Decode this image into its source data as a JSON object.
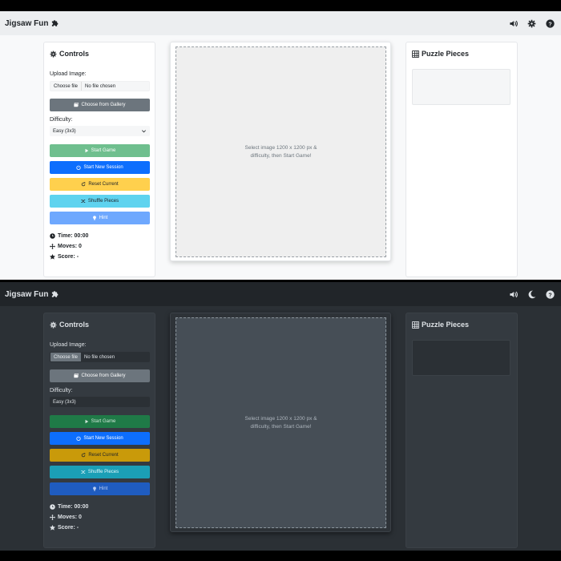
{
  "app": {
    "title": "Jigsaw Fun",
    "brand_icon": "puzzle-icon"
  },
  "controls": {
    "title": "Controls",
    "upload_label": "Upload Image:",
    "file_button": "Choose file",
    "file_status": "No file chosen",
    "gallery_button": "Choose from Gallery",
    "difficulty_label": "Difficulty:",
    "difficulty_value": "Easy (3x3)",
    "start_button": "Start Game",
    "new_session_button": "Start New Session",
    "reset_button": "Reset Current",
    "shuffle_button": "Shuffle Pieces",
    "hint_button": "Hint"
  },
  "stats": {
    "time": "Time: 00:00",
    "moves": "Moves: 0",
    "score": "Score: -"
  },
  "board": {
    "placeholder": "Select image 1200 x 1200 px & difficulty, then Start Game!"
  },
  "pieces": {
    "title": "Puzzle Pieces"
  },
  "themes": {
    "light": {
      "gallery": "#6c757d",
      "start": "#6fbf8e",
      "new_session": "#0d6efd",
      "reset": "#ffd04d",
      "shuffle": "#5fd3ef",
      "hint": "#6ea8fe",
      "dark_text": "#212529",
      "light_text": "#ffffff",
      "theme_icon": "gear-icon"
    },
    "dark": {
      "gallery": "#6c757d",
      "start": "#1f7a47",
      "new_session": "#0d6efd",
      "reset": "#c99a0a",
      "shuffle": "#1b9fb6",
      "hint": "#1f5cc0",
      "dark_text": "#212529",
      "light_text": "#ffffff",
      "theme_icon": "moon-icon"
    }
  }
}
